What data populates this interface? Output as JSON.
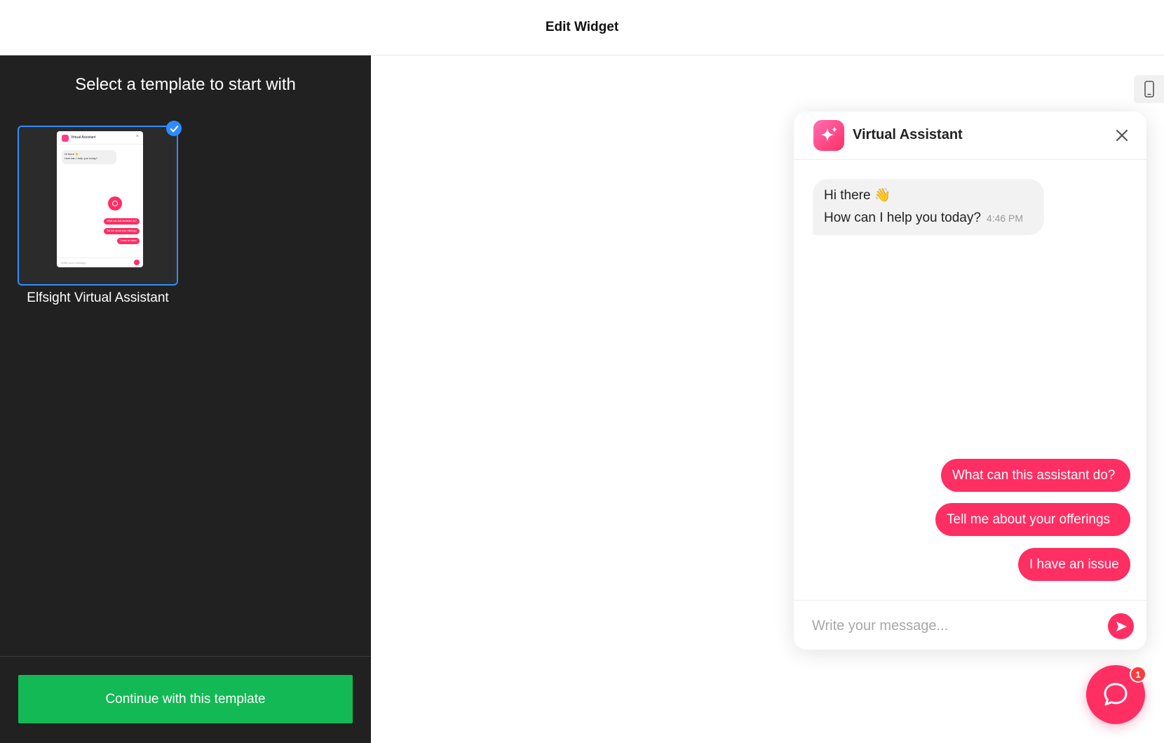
{
  "topbar": {
    "title": "Edit Widget"
  },
  "left_panel": {
    "heading": "Select a template to start with",
    "template": {
      "name": "Elfsight Virtual Assistant",
      "selected": true,
      "thumbnail": {
        "title": "Virtual Assistant",
        "greeting_line1": "Hi there 👋",
        "greeting_line2": "How can I help you today?",
        "chips": [
          "What can this assistant do?",
          "Tell me about your offerings",
          "I have an issue"
        ],
        "placeholder": "Write your message..."
      }
    },
    "continue_label": "Continue with this template"
  },
  "chat": {
    "title": "Virtual Assistant",
    "message_line1": "Hi there 👋",
    "message_line2": "How can I help you today?",
    "message_time": "4:46 PM",
    "quick_replies": [
      "What can this assistant do?",
      "Tell me about your offerings",
      "I have an issue"
    ],
    "input_placeholder": "Write your message...",
    "unread_count": "1"
  },
  "icons": {
    "checkmark": "check-icon",
    "device": "mobile-device-icon",
    "avatar": "sparkle-icon",
    "close": "close-icon",
    "send": "send-icon",
    "launcher": "chat-bubble-icon"
  },
  "colors": {
    "accent": "#ff2e63",
    "primary_button": "#13b955",
    "selection": "#2f8cff",
    "panel_bg": "#212121"
  }
}
